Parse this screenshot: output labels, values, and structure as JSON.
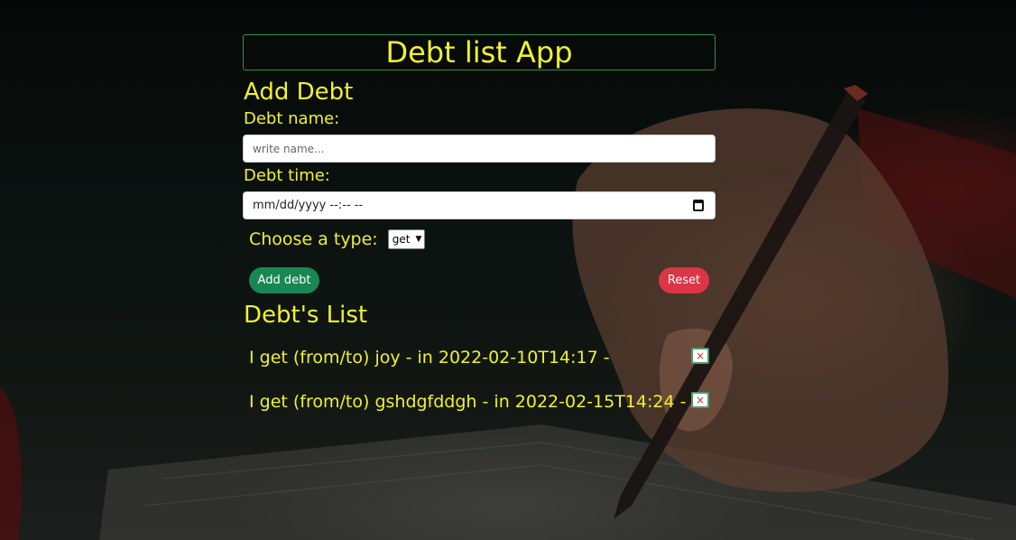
{
  "app": {
    "title": "Debt list App"
  },
  "form": {
    "heading": "Add Debt",
    "name_label": "Debt name:",
    "name_placeholder": "write name...",
    "time_label": "Debt time:",
    "time_value": "mm/dd/yyyy --:-- --",
    "type_label": "Choose a type:",
    "type_selected": "get",
    "add_button": "Add debt",
    "reset_button": "Reset"
  },
  "list": {
    "heading": "Debt's List",
    "items": [
      {
        "text": "I get (from/to) joy - in 2022-02-10T14:17 -",
        "delete": "×"
      },
      {
        "text": "I get (from/to) gshdgfddgh - in 2022-02-15T14:24 -",
        "delete": "×"
      }
    ]
  },
  "colors": {
    "text": "#f1f12a",
    "add_button": "#198754",
    "reset_button": "#dc3545",
    "title_border": "#2f8f4f"
  },
  "icons": {
    "calendar": "calendar-icon",
    "select_chevron": "chevron-down-icon",
    "delete": "close-icon"
  }
}
